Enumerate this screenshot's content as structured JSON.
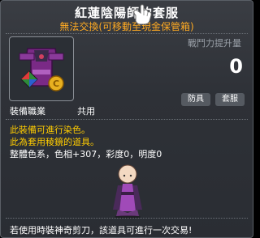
{
  "item": {
    "name": "紅蓮陰陽師的套服",
    "trade_note": "無法交換(可移動至現金保管箱)",
    "power_label": "戰鬥力提升量",
    "power_value": "0",
    "tags": [
      "防具",
      "套服"
    ],
    "job_label": "裝備職業",
    "job_value": "共用",
    "dye_line1": "此裝備可進行染色。",
    "dye_line2": "此為套用稜鏡的道具。",
    "color_info": "整體色系，色相+307，彩度0，明度0",
    "footer": "若使用時裝神奇剪刀，該道具可進行一次交易!"
  },
  "colors": {
    "title": "#ffffff",
    "trade_note": "#ffaa22",
    "dye_text": "#ffcc00",
    "tooltip_bg": "#2e3137"
  }
}
